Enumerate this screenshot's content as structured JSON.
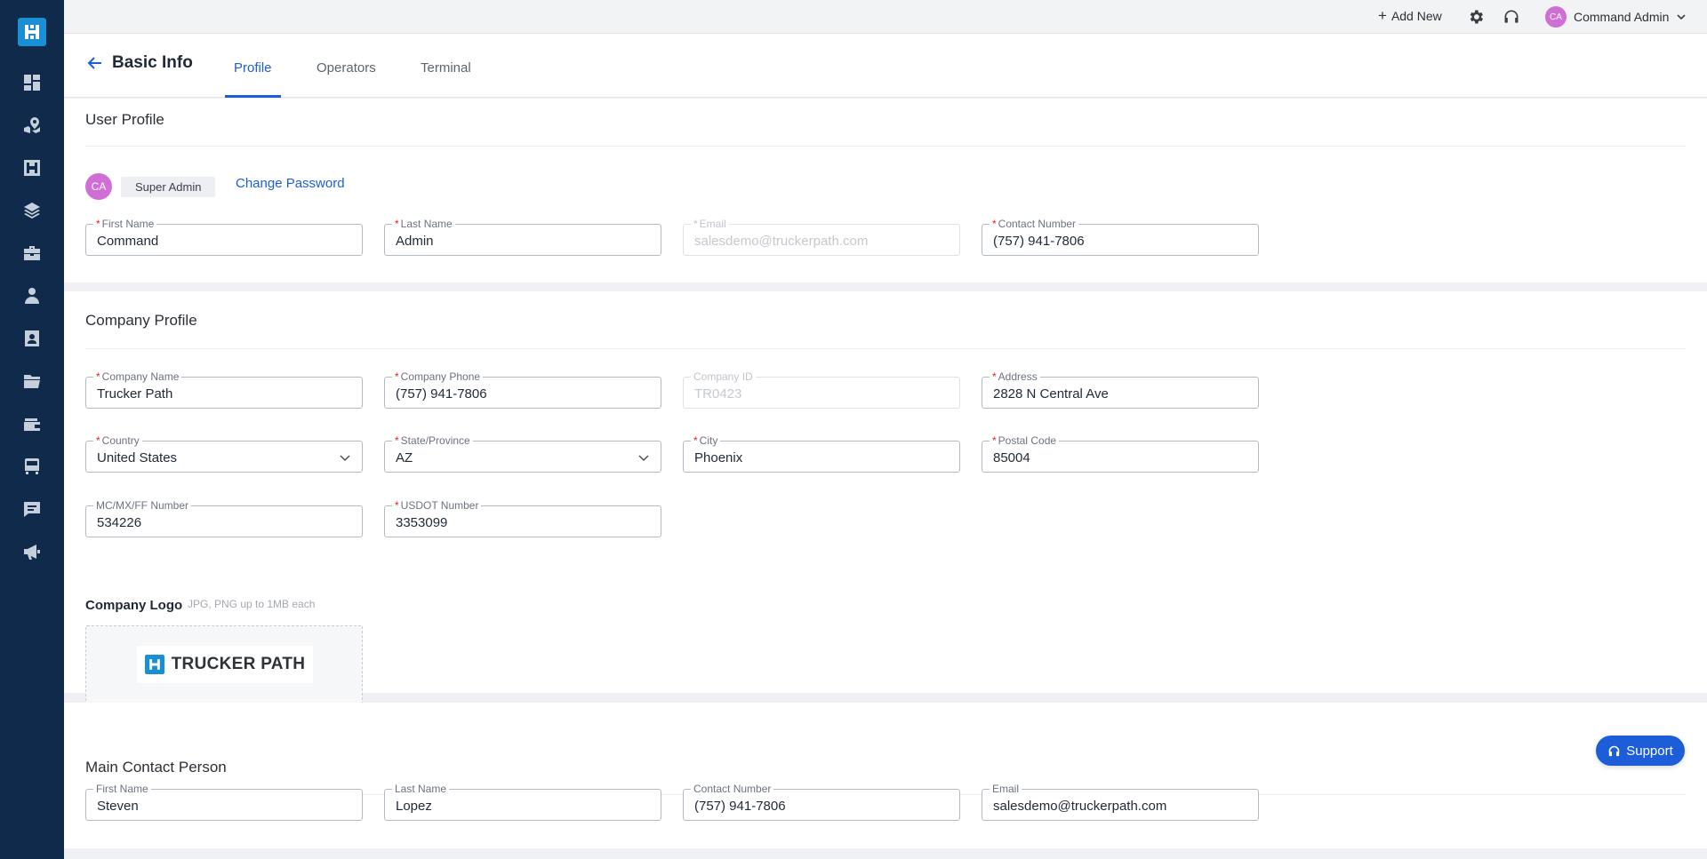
{
  "sidebar": {
    "logo": "trucker-path-logo",
    "items": [
      {
        "icon": "dashboard-icon"
      },
      {
        "icon": "map-pin-icon"
      },
      {
        "icon": "dispatch-icon"
      },
      {
        "icon": "layers-icon"
      },
      {
        "icon": "briefcase-icon"
      },
      {
        "icon": "driver-icon"
      },
      {
        "icon": "contacts-icon"
      },
      {
        "icon": "folder-icon"
      },
      {
        "icon": "wallet-icon"
      },
      {
        "icon": "truck-icon"
      },
      {
        "icon": "message-icon"
      },
      {
        "icon": "megaphone-icon"
      }
    ]
  },
  "topbar": {
    "add_new": "Add New",
    "user_initials": "CA",
    "user_name": "Command Admin"
  },
  "header": {
    "title": "Basic Info",
    "tabs": [
      "Profile",
      "Operators",
      "Terminal"
    ],
    "active_tab": "Profile"
  },
  "user_profile": {
    "title": "User Profile",
    "initials": "CA",
    "role": "Super Admin",
    "change_password": "Change Password",
    "fields": {
      "first_name": {
        "label": "First Name",
        "value": "Command",
        "required": true
      },
      "last_name": {
        "label": "Last Name",
        "value": "Admin",
        "required": true
      },
      "email": {
        "label": "Email",
        "value": "salesdemo@truckerpath.com",
        "required": true,
        "disabled": true
      },
      "contact_number": {
        "label": "Contact Number",
        "value": "(757) 941-7806",
        "required": true
      }
    }
  },
  "company_profile": {
    "title": "Company Profile",
    "fields": {
      "company_name": {
        "label": "Company Name",
        "value": "Trucker Path"
      },
      "company_phone": {
        "label": "Company Phone",
        "value": "(757) 941-7806"
      },
      "company_id": {
        "label": "Company ID",
        "value": "TR0423"
      },
      "address": {
        "label": "Address",
        "value": "2828 N Central Ave"
      },
      "country": {
        "label": "Country",
        "value": "United States"
      },
      "state": {
        "label": "State/Province",
        "value": "AZ"
      },
      "city": {
        "label": "City",
        "value": "Phoenix"
      },
      "postal_code": {
        "label": "Postal Code",
        "value": "85004"
      },
      "mc_number": {
        "label": "MC/MX/FF Number",
        "value": "534226"
      },
      "usdot_number": {
        "label": "USDOT Number",
        "value": "3353099"
      }
    },
    "logo_label": "Company Logo",
    "logo_hint": "JPG, PNG up to 1MB each",
    "logo_text": "TRUCKER PATH"
  },
  "main_contact": {
    "title": "Main Contact Person",
    "fields": {
      "first_name": {
        "label": "First Name",
        "value": "Steven"
      },
      "last_name": {
        "label": "Last Name",
        "value": "Lopez"
      },
      "contact_number": {
        "label": "Contact Number",
        "value": "(757) 941-7806"
      },
      "email": {
        "label": "Email",
        "value": "salesdemo@truckerpath.com"
      }
    }
  },
  "support": {
    "label": "Support"
  },
  "colors": {
    "sidebar_bg": "#0f2a4a",
    "accent": "#1d5ed8",
    "avatar": "#cf6ed4",
    "required": "#e02424"
  }
}
